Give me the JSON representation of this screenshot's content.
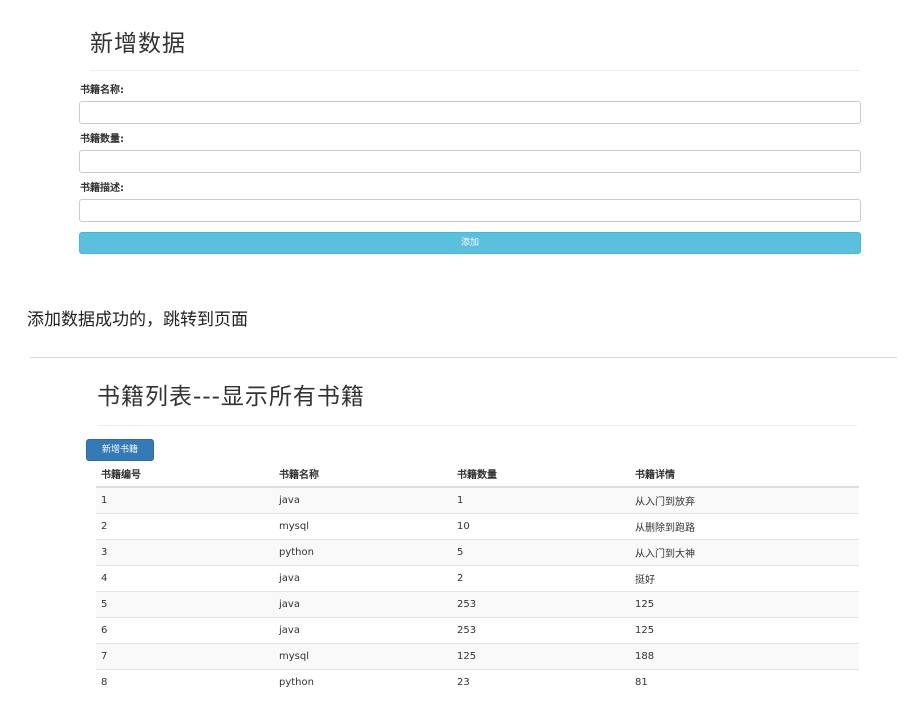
{
  "add_form": {
    "title": "新增数据",
    "fields": [
      {
        "label": "书籍名称:",
        "value": "",
        "placeholder": ""
      },
      {
        "label": "书籍数量:",
        "value": "",
        "placeholder": ""
      },
      {
        "label": "书籍描述:",
        "value": "",
        "placeholder": ""
      }
    ],
    "submit_label": "添加"
  },
  "note": "添加数据成功的，跳转到页面",
  "book_list": {
    "title": "书籍列表---显示所有书籍",
    "new_button_label": "新增书籍",
    "columns": [
      "书籍编号",
      "书籍名称",
      "书籍数量",
      "书籍详情"
    ],
    "rows": [
      [
        "1",
        "java",
        "1",
        "从入门到放弃"
      ],
      [
        "2",
        "mysql",
        "10",
        "从删除到跑路"
      ],
      [
        "3",
        "python",
        "5",
        "从入门到大神"
      ],
      [
        "4",
        "java",
        "2",
        "挺好"
      ],
      [
        "5",
        "java",
        "253",
        "125"
      ],
      [
        "6",
        "java",
        "253",
        "125"
      ],
      [
        "7",
        "mysql",
        "125",
        "188"
      ],
      [
        "8",
        "python",
        "23",
        "81"
      ]
    ]
  },
  "colors": {
    "info_button": "#5bc0de",
    "primary_button": "#337ab7",
    "striped_row": "#f9f9f9"
  }
}
